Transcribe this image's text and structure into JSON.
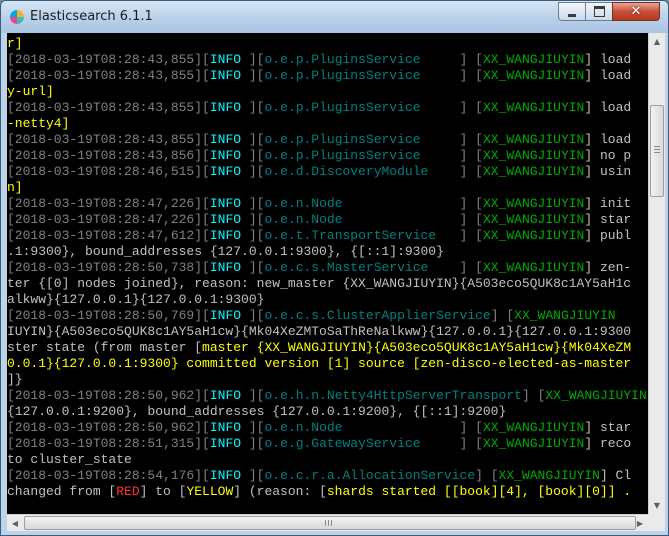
{
  "window": {
    "title": "Elasticsearch 6.1.1"
  },
  "console": {
    "lines": [
      [
        {
          "t": "r]",
          "c": "c-y"
        }
      ],
      [
        {
          "t": "[2018-03-19T08:28:43,855]",
          "c": "c-ts"
        },
        {
          "t": "[",
          "c": "c-brk"
        },
        {
          "t": "INFO ",
          "c": "c-lvl"
        },
        {
          "t": "][",
          "c": "c-brk"
        },
        {
          "t": "o.e.p.PluginsService     ",
          "c": "c-mod"
        },
        {
          "t": "] [",
          "c": "c-brk"
        },
        {
          "t": "XX_WANGJIUYIN",
          "c": "c-node"
        },
        {
          "t": "] load",
          "c": "c-txt"
        }
      ],
      [
        {
          "t": "[2018-03-19T08:28:43,855]",
          "c": "c-ts"
        },
        {
          "t": "[",
          "c": "c-brk"
        },
        {
          "t": "INFO ",
          "c": "c-lvl"
        },
        {
          "t": "][",
          "c": "c-brk"
        },
        {
          "t": "o.e.p.PluginsService     ",
          "c": "c-mod"
        },
        {
          "t": "] [",
          "c": "c-brk"
        },
        {
          "t": "XX_WANGJIUYIN",
          "c": "c-node"
        },
        {
          "t": "] load",
          "c": "c-txt"
        }
      ],
      [
        {
          "t": "y-url]",
          "c": "c-y"
        }
      ],
      [
        {
          "t": "[2018-03-19T08:28:43,855]",
          "c": "c-ts"
        },
        {
          "t": "[",
          "c": "c-brk"
        },
        {
          "t": "INFO ",
          "c": "c-lvl"
        },
        {
          "t": "][",
          "c": "c-brk"
        },
        {
          "t": "o.e.p.PluginsService     ",
          "c": "c-mod"
        },
        {
          "t": "] [",
          "c": "c-brk"
        },
        {
          "t": "XX_WANGJIUYIN",
          "c": "c-node"
        },
        {
          "t": "] load",
          "c": "c-txt"
        }
      ],
      [
        {
          "t": "-netty4]",
          "c": "c-y"
        }
      ],
      [
        {
          "t": "[2018-03-19T08:28:43,855]",
          "c": "c-ts"
        },
        {
          "t": "[",
          "c": "c-brk"
        },
        {
          "t": "INFO ",
          "c": "c-lvl"
        },
        {
          "t": "][",
          "c": "c-brk"
        },
        {
          "t": "o.e.p.PluginsService     ",
          "c": "c-mod"
        },
        {
          "t": "] [",
          "c": "c-brk"
        },
        {
          "t": "XX_WANGJIUYIN",
          "c": "c-node"
        },
        {
          "t": "] load",
          "c": "c-txt"
        }
      ],
      [
        {
          "t": "[2018-03-19T08:28:43,856]",
          "c": "c-ts"
        },
        {
          "t": "[",
          "c": "c-brk"
        },
        {
          "t": "INFO ",
          "c": "c-lvl"
        },
        {
          "t": "][",
          "c": "c-brk"
        },
        {
          "t": "o.e.p.PluginsService     ",
          "c": "c-mod"
        },
        {
          "t": "] [",
          "c": "c-brk"
        },
        {
          "t": "XX_WANGJIUYIN",
          "c": "c-node"
        },
        {
          "t": "] no p",
          "c": "c-txt"
        }
      ],
      [
        {
          "t": "[2018-03-19T08:28:46,515]",
          "c": "c-ts"
        },
        {
          "t": "[",
          "c": "c-brk"
        },
        {
          "t": "INFO ",
          "c": "c-lvl"
        },
        {
          "t": "][",
          "c": "c-brk"
        },
        {
          "t": "o.e.d.DiscoveryModule    ",
          "c": "c-mod"
        },
        {
          "t": "] [",
          "c": "c-brk"
        },
        {
          "t": "XX_WANGJIUYIN",
          "c": "c-node"
        },
        {
          "t": "] usin",
          "c": "c-txt"
        }
      ],
      [
        {
          "t": "n]",
          "c": "c-y"
        }
      ],
      [
        {
          "t": "[2018-03-19T08:28:47,226]",
          "c": "c-ts"
        },
        {
          "t": "[",
          "c": "c-brk"
        },
        {
          "t": "INFO ",
          "c": "c-lvl"
        },
        {
          "t": "][",
          "c": "c-brk"
        },
        {
          "t": "o.e.n.Node               ",
          "c": "c-mod"
        },
        {
          "t": "] [",
          "c": "c-brk"
        },
        {
          "t": "XX_WANGJIUYIN",
          "c": "c-node"
        },
        {
          "t": "] init",
          "c": "c-txt"
        }
      ],
      [
        {
          "t": "[2018-03-19T08:28:47,226]",
          "c": "c-ts"
        },
        {
          "t": "[",
          "c": "c-brk"
        },
        {
          "t": "INFO ",
          "c": "c-lvl"
        },
        {
          "t": "][",
          "c": "c-brk"
        },
        {
          "t": "o.e.n.Node               ",
          "c": "c-mod"
        },
        {
          "t": "] [",
          "c": "c-brk"
        },
        {
          "t": "XX_WANGJIUYIN",
          "c": "c-node"
        },
        {
          "t": "] star",
          "c": "c-txt"
        }
      ],
      [
        {
          "t": "[2018-03-19T08:28:47,612]",
          "c": "c-ts"
        },
        {
          "t": "[",
          "c": "c-brk"
        },
        {
          "t": "INFO ",
          "c": "c-lvl"
        },
        {
          "t": "][",
          "c": "c-brk"
        },
        {
          "t": "o.e.t.TransportService   ",
          "c": "c-mod"
        },
        {
          "t": "] [",
          "c": "c-brk"
        },
        {
          "t": "XX_WANGJIUYIN",
          "c": "c-node"
        },
        {
          "t": "] publ",
          "c": "c-txt"
        }
      ],
      [
        {
          "t": ".1:9300}, bound_addresses {127.0.0.1:9300}, {[::1]:9300}",
          "c": "c-txt"
        }
      ],
      [
        {
          "t": "[2018-03-19T08:28:50,738]",
          "c": "c-ts"
        },
        {
          "t": "[",
          "c": "c-brk"
        },
        {
          "t": "INFO ",
          "c": "c-lvl"
        },
        {
          "t": "][",
          "c": "c-brk"
        },
        {
          "t": "o.e.c.s.MasterService    ",
          "c": "c-mod"
        },
        {
          "t": "] [",
          "c": "c-brk"
        },
        {
          "t": "XX_WANGJIUYIN",
          "c": "c-node"
        },
        {
          "t": "] zen-",
          "c": "c-txt"
        }
      ],
      [
        {
          "t": "ter {[0] nodes joined}, reason: new_master {XX_WANGJIUYIN}{A503eco5QUK8c1AY5aH1c",
          "c": "c-txt"
        }
      ],
      [
        {
          "t": "alkww}{127.0.0.1}{127.0.0.1:9300}",
          "c": "c-txt"
        }
      ],
      [
        {
          "t": "[2018-03-19T08:28:50,769]",
          "c": "c-ts"
        },
        {
          "t": "[",
          "c": "c-brk"
        },
        {
          "t": "INFO ",
          "c": "c-lvl"
        },
        {
          "t": "][",
          "c": "c-brk"
        },
        {
          "t": "o.e.c.s.ClusterApplierService",
          "c": "c-mod"
        },
        {
          "t": "] [",
          "c": "c-brk"
        },
        {
          "t": "XX_WANGJIUYIN",
          "c": "c-node"
        }
      ],
      [
        {
          "t": "IUYIN}{A503eco5QUK8c1AY5aH1cw}{Mk04XeZMToSaThReNalkww}{127.0.0.1}{127.0.0.1:9300",
          "c": "c-txt"
        }
      ],
      [
        {
          "t": "ster state (from master [",
          "c": "c-txt"
        },
        {
          "t": "master {XX_WANGJIUYIN}{A503eco5QUK8c1AY5aH1cw}{Mk04XeZM",
          "c": "c-y"
        }
      ],
      [
        {
          "t": "0.0.1}{127.0.0.1:9300} committed version [1] source [zen-disco-elected-as-master",
          "c": "c-y"
        }
      ],
      [
        {
          "t": "]}",
          "c": "c-txt"
        }
      ],
      [
        {
          "t": "[2018-03-19T08:28:50,962]",
          "c": "c-ts"
        },
        {
          "t": "[",
          "c": "c-brk"
        },
        {
          "t": "INFO ",
          "c": "c-lvl"
        },
        {
          "t": "][",
          "c": "c-brk"
        },
        {
          "t": "o.e.h.n.Netty4HttpServerTransport",
          "c": "c-mod"
        },
        {
          "t": "] [",
          "c": "c-brk"
        },
        {
          "t": "XX_WANGJIUYIN",
          "c": "c-node"
        }
      ],
      [
        {
          "t": "{127.0.0.1:9200}, bound_addresses {127.0.0.1:9200}, {[::1]:9200}",
          "c": "c-txt"
        }
      ],
      [
        {
          "t": "[2018-03-19T08:28:50,962]",
          "c": "c-ts"
        },
        {
          "t": "[",
          "c": "c-brk"
        },
        {
          "t": "INFO ",
          "c": "c-lvl"
        },
        {
          "t": "][",
          "c": "c-brk"
        },
        {
          "t": "o.e.n.Node               ",
          "c": "c-mod"
        },
        {
          "t": "] [",
          "c": "c-brk"
        },
        {
          "t": "XX_WANGJIUYIN",
          "c": "c-node"
        },
        {
          "t": "] star",
          "c": "c-txt"
        }
      ],
      [
        {
          "t": "[2018-03-19T08:28:51,315]",
          "c": "c-ts"
        },
        {
          "t": "[",
          "c": "c-brk"
        },
        {
          "t": "INFO ",
          "c": "c-lvl"
        },
        {
          "t": "][",
          "c": "c-brk"
        },
        {
          "t": "o.e.g.GatewayService     ",
          "c": "c-mod"
        },
        {
          "t": "] [",
          "c": "c-brk"
        },
        {
          "t": "XX_WANGJIUYIN",
          "c": "c-node"
        },
        {
          "t": "] reco",
          "c": "c-txt"
        }
      ],
      [
        {
          "t": "to cluster_state",
          "c": "c-txt"
        }
      ],
      [
        {
          "t": "[2018-03-19T08:28:54,176]",
          "c": "c-ts"
        },
        {
          "t": "[",
          "c": "c-brk"
        },
        {
          "t": "INFO ",
          "c": "c-lvl"
        },
        {
          "t": "][",
          "c": "c-brk"
        },
        {
          "t": "o.e.c.r.a.AllocationService",
          "c": "c-mod"
        },
        {
          "t": "] [",
          "c": "c-brk"
        },
        {
          "t": "XX_WANGJIUYIN",
          "c": "c-node"
        },
        {
          "t": "] Cl",
          "c": "c-txt"
        }
      ],
      [
        {
          "t": "changed from [",
          "c": "c-txt"
        },
        {
          "t": "RED",
          "c": "c-r"
        },
        {
          "t": "] to [",
          "c": "c-txt"
        },
        {
          "t": "YELLOW",
          "c": "c-y"
        },
        {
          "t": "] (reason: [",
          "c": "c-txt"
        },
        {
          "t": "shards started [[book][4], [book][0]] .",
          "c": "c-y"
        }
      ]
    ]
  },
  "icons": {
    "app": "elasticsearch-logo-icon",
    "minimize": "minimize-icon",
    "maximize": "maximize-icon",
    "close": "close-icon",
    "close_glyph": "✕",
    "scroll_up": "▲",
    "scroll_down": "▼",
    "scroll_left": "◀",
    "scroll_right": "▶"
  },
  "colors": {
    "console_bg": "#000000",
    "timestamp": "#808080",
    "level": "#00ffff",
    "module": "#008080",
    "node": "#00aa00",
    "highlight": "#ffff00",
    "red": "#ff3333",
    "titlebar": "#bcd3ea"
  }
}
